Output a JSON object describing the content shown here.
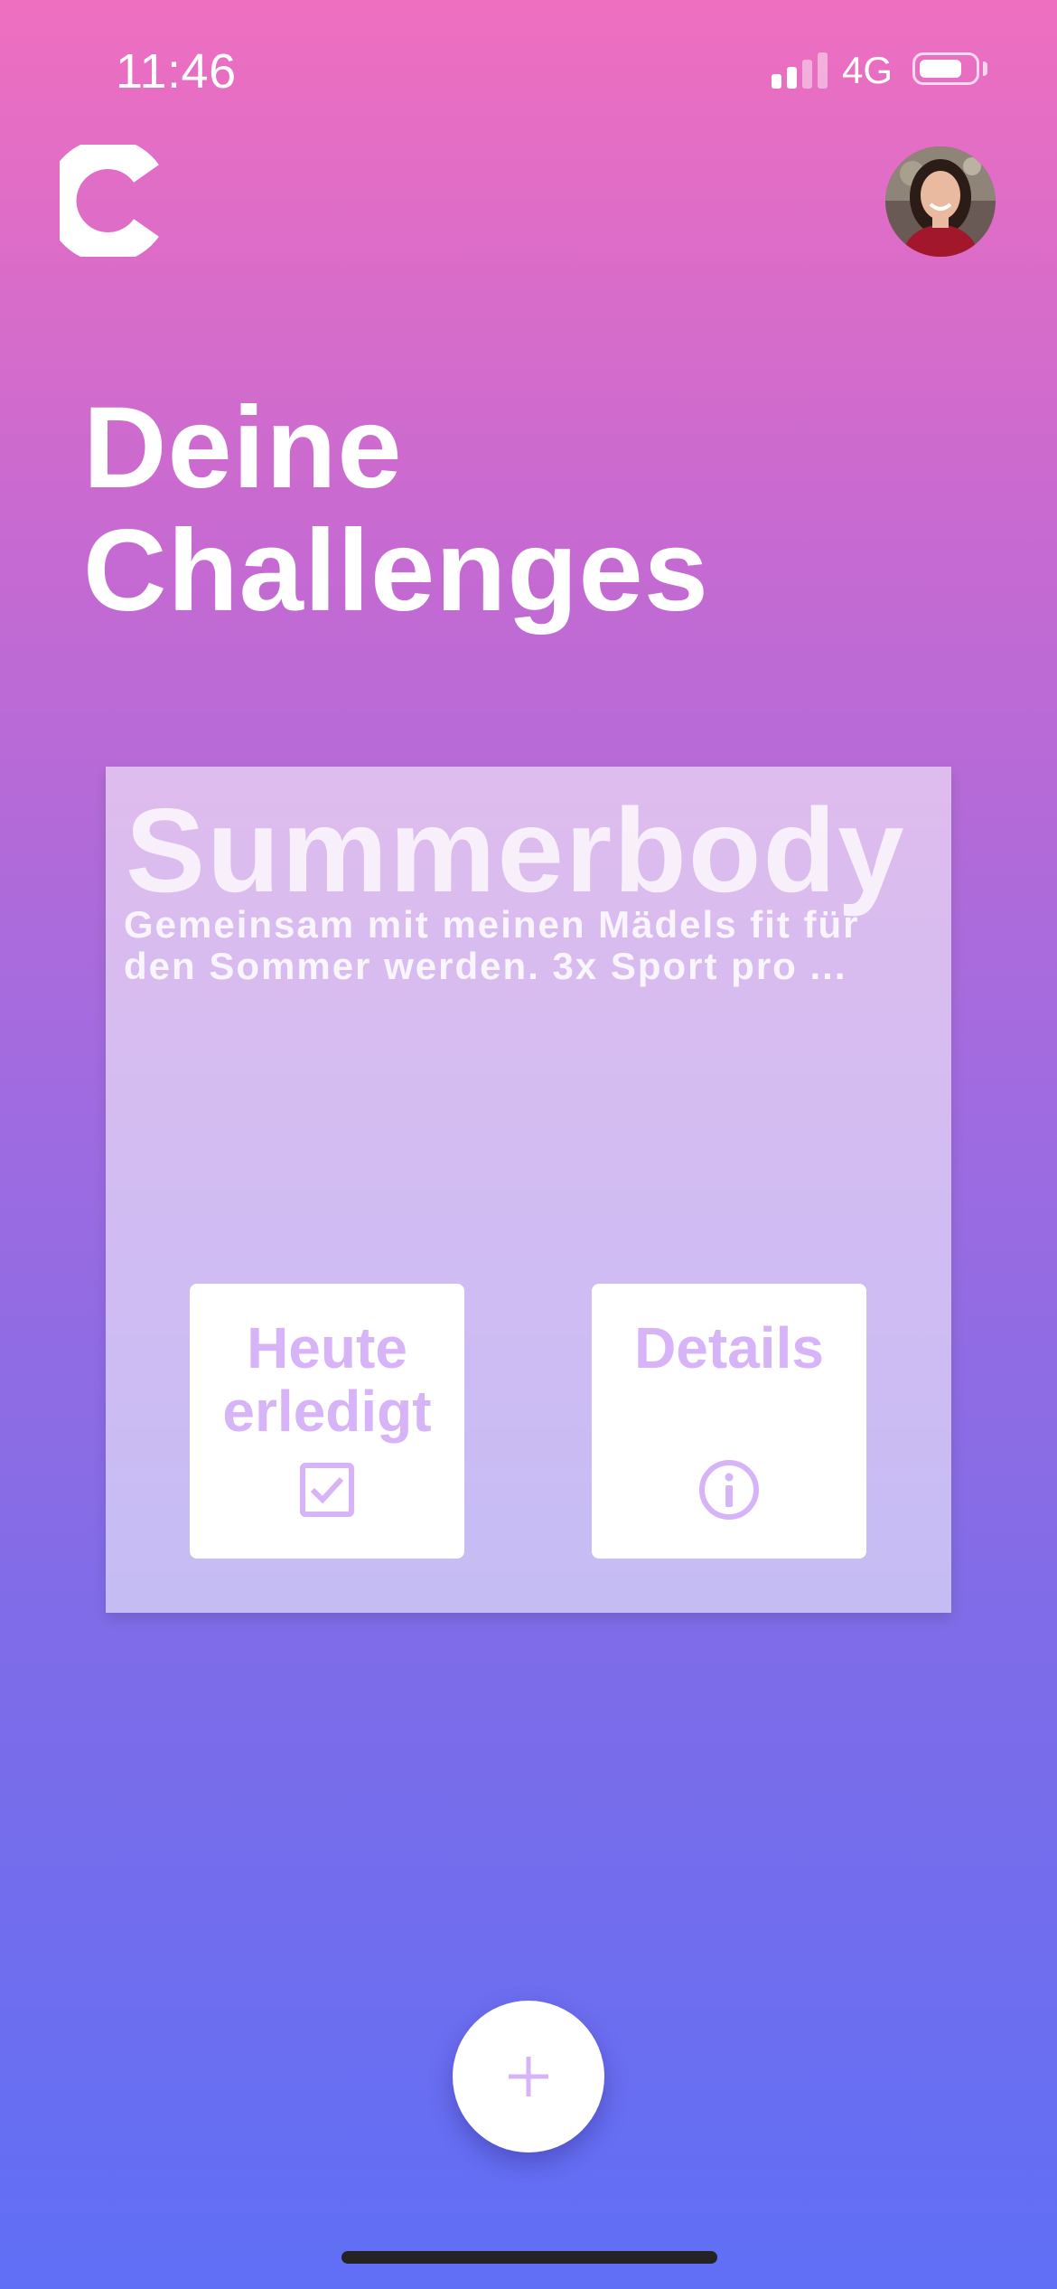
{
  "status_bar": {
    "time": "11:46",
    "network": "4G",
    "signal_bars_active": 2,
    "signal_bars_total": 4
  },
  "header": {
    "logo_icon": "challenge-logo-icon",
    "avatar_icon": "profile-avatar"
  },
  "page": {
    "title_line1": "Deine",
    "title_line2": "Challenges"
  },
  "challenge_card": {
    "title": "Summerbody",
    "description_line1": "Gemeinsam mit meinen Mädels fit für",
    "description_line2": "den Sommer werden. 3x Sport pro ...",
    "done_button": {
      "label_line1": "Heute",
      "label_line2": "erledigt",
      "icon": "checkbox-checked-icon"
    },
    "details_button": {
      "label": "Details",
      "icon": "info-icon"
    }
  },
  "fab": {
    "icon": "plus-icon"
  },
  "colors": {
    "accent": "#D6B4F7",
    "gradient_top": "#EE6FC0",
    "gradient_bottom": "#5F6FF6"
  }
}
